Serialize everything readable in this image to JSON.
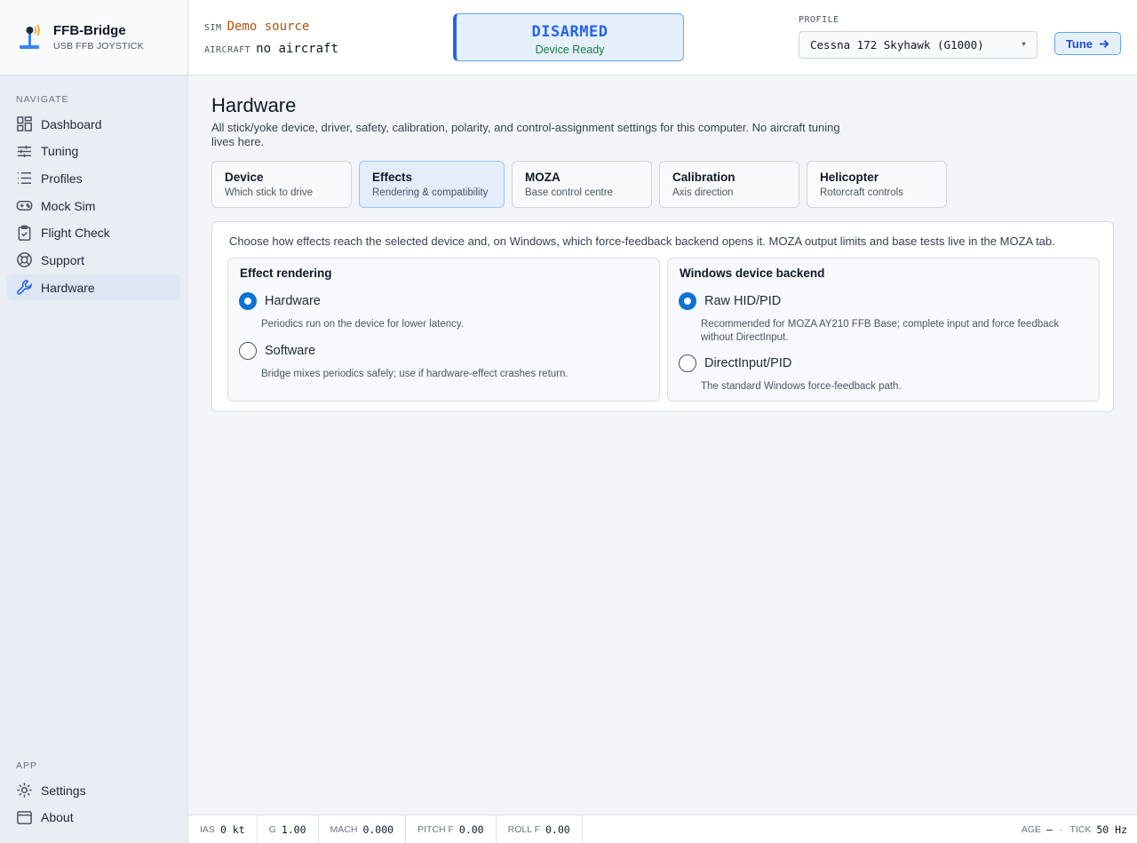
{
  "brand": {
    "title": "FFB-Bridge",
    "subtitle": "USB FFB JOYSTICK"
  },
  "nav": {
    "heading": "NAVIGATE",
    "items": [
      {
        "label": "Dashboard",
        "icon": "dashboard-icon"
      },
      {
        "label": "Tuning",
        "icon": "sliders-icon"
      },
      {
        "label": "Profiles",
        "icon": "list-icon"
      },
      {
        "label": "Mock Sim",
        "icon": "gamepad-icon"
      },
      {
        "label": "Flight Check",
        "icon": "clipboard-check-icon"
      },
      {
        "label": "Support",
        "icon": "lifebuoy-icon"
      },
      {
        "label": "Hardware",
        "icon": "wrench-icon",
        "active": true
      }
    ],
    "app_heading": "APP",
    "app_items": [
      {
        "label": "Settings",
        "icon": "gear-icon"
      },
      {
        "label": "About",
        "icon": "window-icon"
      }
    ]
  },
  "header": {
    "sim_label": "SIM",
    "sim_value": "Demo source",
    "aircraft_label": "AIRCRAFT",
    "aircraft_value": "no aircraft",
    "status": "DISARMED",
    "status_sub": "Device Ready",
    "profile_label": "PROFILE",
    "profile_value": "Cessna 172 Skyhawk (G1000)",
    "tune_label": "Tune"
  },
  "page": {
    "title": "Hardware",
    "description": "All stick/yoke device, driver, safety, calibration, polarity, and control-assignment settings for this computer. No aircraft tuning lives here."
  },
  "tabs": [
    {
      "title": "Device",
      "sub": "Which stick to drive"
    },
    {
      "title": "Effects",
      "sub": "Rendering & compatibility",
      "active": true
    },
    {
      "title": "MOZA",
      "sub": "Base control centre"
    },
    {
      "title": "Calibration",
      "sub": "Axis direction"
    },
    {
      "title": "Helicopter",
      "sub": "Rotorcraft controls"
    }
  ],
  "effects": {
    "intro": "Choose how effects reach the selected device and, on Windows, which force-feedback backend opens it. MOZA output limits and base tests live in the MOZA tab.",
    "rendering": {
      "title": "Effect rendering",
      "options": [
        {
          "label": "Hardware",
          "help": "Periodics run on the device for lower latency.",
          "checked": true
        },
        {
          "label": "Software",
          "help": "Bridge mixes periodics safely; use if hardware-effect crashes return.",
          "checked": false
        }
      ]
    },
    "backend": {
      "title": "Windows device backend",
      "options": [
        {
          "label": "Raw HID/PID",
          "help": "Recommended for MOZA AY210 FFB Base; complete input and force feedback without DirectInput.",
          "checked": true
        },
        {
          "label": "DirectInput/PID",
          "help": "The standard Windows force-feedback path.",
          "checked": false
        }
      ]
    }
  },
  "statusbar": {
    "ias_label": "IAS",
    "ias_value": "0 kt",
    "g_label": "G",
    "g_value": "1.00",
    "mach_label": "MACH",
    "mach_value": "0.000",
    "pitch_label": "PITCH F",
    "pitch_value": "0.00",
    "roll_label": "ROLL F",
    "roll_value": "0.00",
    "age_label": "AGE",
    "age_value": "—",
    "sep": "·",
    "tick_label": "TICK",
    "tick_value": "50 Hz"
  }
}
